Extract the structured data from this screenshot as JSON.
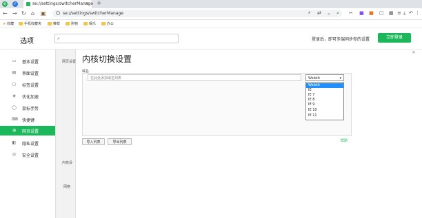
{
  "browser": {
    "tab_title": "se://settings/switcherManage",
    "new_tab": "+",
    "url": "se://settings/switcherManage"
  },
  "bookmarks": [
    "收藏",
    "手机收藏夹",
    "推荐",
    "购物",
    "娱乐",
    "办公"
  ],
  "header": {
    "title": "选项",
    "search_placeholder": "",
    "hint": "登录后，即可多端同步你的设置",
    "login_button": "立即登录"
  },
  "sidebar": {
    "items": [
      {
        "label": "基本设置",
        "icon": "monitor-icon"
      },
      {
        "label": "界面设置",
        "icon": "layout-icon"
      },
      {
        "label": "标签设置",
        "icon": "tab-icon"
      },
      {
        "label": "优化加速",
        "icon": "rocket-icon"
      },
      {
        "label": "鼠标手势",
        "icon": "mouse-icon"
      },
      {
        "label": "快捷键",
        "icon": "keyboard-icon"
      },
      {
        "label": "网页设置",
        "icon": "globe-icon",
        "active": true
      },
      {
        "label": "隐私设置",
        "icon": "privacy-icon"
      },
      {
        "label": "安全设置",
        "icon": "shield-icon"
      }
    ]
  },
  "col2": {
    "labels": [
      "网页设置",
      "内核设",
      "网络"
    ]
  },
  "main": {
    "title": "内核切换设置",
    "domain_label": "域名",
    "row_input": "在此处添加域名列表",
    "dropdown_value": "Webkit",
    "options": [
      "Webkit",
      "IE",
      "IE 7",
      "IE 8",
      "IE 9",
      "IE 10",
      "IE 11"
    ],
    "import_button": "导入列表",
    "export_button": "导出列表",
    "help": "帮助"
  },
  "colors": {
    "accent": "#1ab85a",
    "selected": "#1e90ff"
  }
}
